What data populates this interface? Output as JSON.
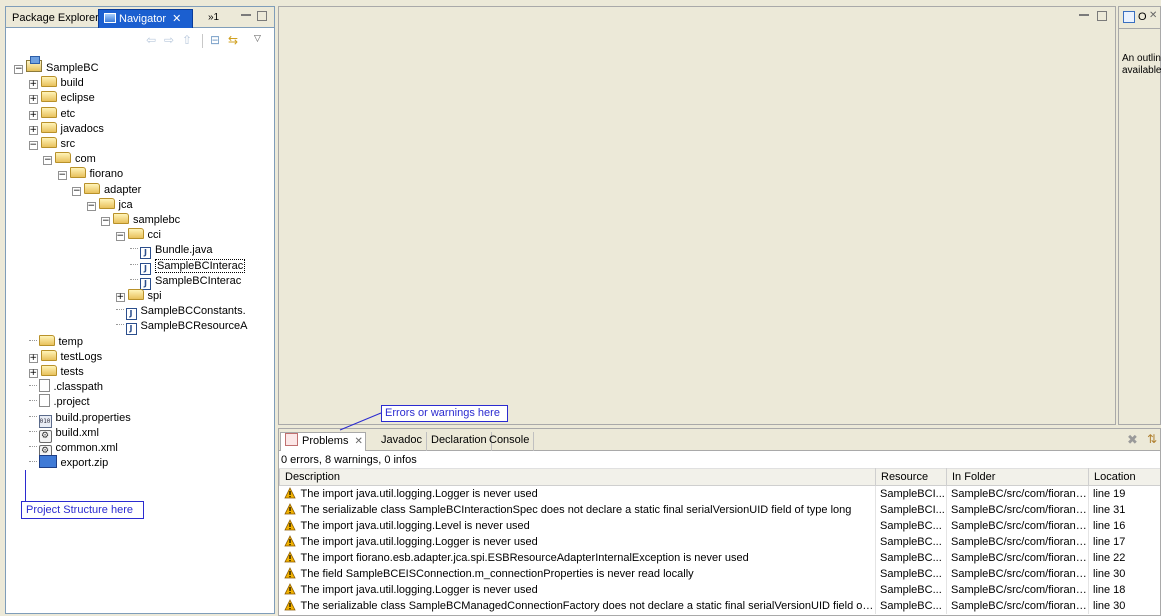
{
  "left_view": {
    "tabs": {
      "package_explorer": "Package Explorer",
      "navigator": "Navigator",
      "more": "»1"
    },
    "tree": [
      {
        "label": "SampleBC",
        "icon": "project-icon",
        "depth": 0,
        "expander": "−"
      },
      {
        "label": "build",
        "icon": "folder-icon",
        "depth": 1,
        "expander": "+"
      },
      {
        "label": "eclipse",
        "icon": "folder-icon",
        "depth": 1,
        "expander": "+"
      },
      {
        "label": "etc",
        "icon": "folder-icon",
        "depth": 1,
        "expander": "+"
      },
      {
        "label": "javadocs",
        "icon": "folder-icon",
        "depth": 1,
        "expander": "+"
      },
      {
        "label": "src",
        "icon": "folder-icon",
        "depth": 1,
        "expander": "−"
      },
      {
        "label": "com",
        "icon": "folder-icon",
        "depth": 2,
        "expander": "−"
      },
      {
        "label": "fiorano",
        "icon": "folder-icon",
        "depth": 3,
        "expander": "−"
      },
      {
        "label": "adapter",
        "icon": "folder-icon",
        "depth": 4,
        "expander": "−"
      },
      {
        "label": "jca",
        "icon": "folder-icon",
        "depth": 5,
        "expander": "−"
      },
      {
        "label": "samplebc",
        "icon": "folder-icon",
        "depth": 6,
        "expander": "−"
      },
      {
        "label": "cci",
        "icon": "folder-icon",
        "depth": 7,
        "expander": "−"
      },
      {
        "label": "Bundle.java",
        "icon": "java-file-icon",
        "depth": 8,
        "expander": ""
      },
      {
        "label": "SampleBCInterac",
        "icon": "java-file-icon",
        "depth": 8,
        "expander": "",
        "selected": true
      },
      {
        "label": "SampleBCInterac",
        "icon": "java-file-icon",
        "depth": 8,
        "expander": ""
      },
      {
        "label": "spi",
        "icon": "folder-icon",
        "depth": 7,
        "expander": "+"
      },
      {
        "label": "SampleBCConstants.",
        "icon": "java-file-icon",
        "depth": 7,
        "expander": ""
      },
      {
        "label": "SampleBCResourceA",
        "icon": "java-file-icon",
        "depth": 7,
        "expander": ""
      },
      {
        "label": "temp",
        "icon": "folder-icon",
        "depth": 1,
        "expander": ""
      },
      {
        "label": "testLogs",
        "icon": "folder-icon",
        "depth": 1,
        "expander": "+"
      },
      {
        "label": "tests",
        "icon": "folder-icon",
        "depth": 1,
        "expander": "+"
      },
      {
        "label": ".classpath",
        "icon": "document-icon",
        "depth": 1,
        "expander": ""
      },
      {
        "label": ".project",
        "icon": "document-icon",
        "depth": 1,
        "expander": ""
      },
      {
        "label": "build.properties",
        "icon": "properties-file-icon",
        "depth": 1,
        "expander": ""
      },
      {
        "label": "build.xml",
        "icon": "xml-file-icon",
        "depth": 1,
        "expander": ""
      },
      {
        "label": "common.xml",
        "icon": "xml-file-icon",
        "depth": 1,
        "expander": ""
      },
      {
        "label": "export.zip",
        "icon": "zip-file-icon",
        "depth": 1,
        "expander": ""
      }
    ]
  },
  "outline_view": {
    "tab_label": "O",
    "message": "An outline is not available"
  },
  "problems_view": {
    "tabs": {
      "problems": "Problems",
      "javadoc": "Javadoc",
      "declaration": "Declaration",
      "console": "Console"
    },
    "summary": "0 errors, 8 warnings, 0 infos",
    "columns": {
      "description": "Description",
      "resource": "Resource",
      "folder": "In Folder",
      "location": "Location"
    },
    "rows": [
      {
        "description": "The import java.util.logging.Logger is never used",
        "resource": "SampleBCI...",
        "folder": "SampleBC/src/com/fiorano...",
        "location": "line 19"
      },
      {
        "description": "The serializable class SampleBCInteractionSpec does not declare a static final serialVersionUID field of type long",
        "resource": "SampleBCI...",
        "folder": "SampleBC/src/com/fiorano...",
        "location": "line 31"
      },
      {
        "description": "The import java.util.logging.Level is never used",
        "resource": "SampleBC...",
        "folder": "SampleBC/src/com/fiorano...",
        "location": "line 16"
      },
      {
        "description": "The import java.util.logging.Logger is never used",
        "resource": "SampleBC...",
        "folder": "SampleBC/src/com/fiorano...",
        "location": "line 17"
      },
      {
        "description": "The import fiorano.esb.adapter.jca.spi.ESBResourceAdapterInternalException is never used",
        "resource": "SampleBC...",
        "folder": "SampleBC/src/com/fiorano...",
        "location": "line 22"
      },
      {
        "description": "The field SampleBCEISConnection.m_connectionProperties is never read locally",
        "resource": "SampleBC...",
        "folder": "SampleBC/src/com/fiorano...",
        "location": "line 30"
      },
      {
        "description": "The import java.util.logging.Logger is never used",
        "resource": "SampleBC...",
        "folder": "SampleBC/src/com/fiorano...",
        "location": "line 18"
      },
      {
        "description": "The serializable class SampleBCManagedConnectionFactory does not declare a static final serialVersionUID field of type long",
        "resource": "SampleBC...",
        "folder": "SampleBC/src/com/fiorano...",
        "location": "line 30"
      }
    ]
  },
  "annotations": {
    "errors_callout": "Errors or warnings here",
    "project_callout": "Project Structure here"
  },
  "colors": {
    "active_tab": "#1b5fd0",
    "callout": "#2b2bd0",
    "warning": "#f2b200",
    "chrome": "#ece9d8"
  }
}
